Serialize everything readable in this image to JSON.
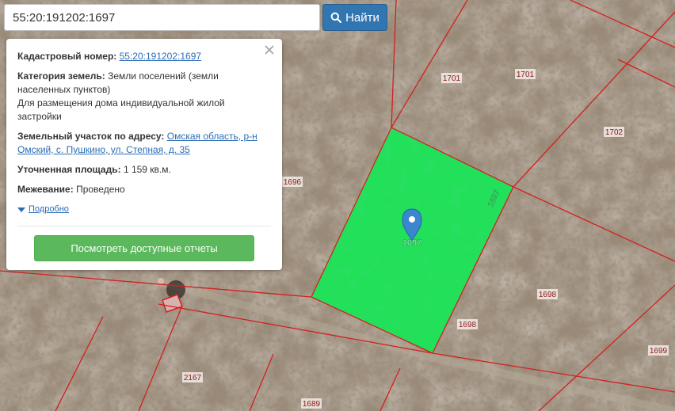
{
  "search": {
    "value": "55:20:191202:1697",
    "button_label": "Найти"
  },
  "info": {
    "cadastral_label": "Кадастровый номер:",
    "cadastral_number": "55:20:191202:1697",
    "category_label": "Категория земель:",
    "category_value": "Земли поселений (земли населенных пунктов)",
    "usage_value": "Для размещения дома индивидуальной жилой застройки",
    "address_label": "Земельный участок по адресу:",
    "address_value": "Омская область, р-н Омский, с. Пушкино, ул. Степная, д. 35",
    "area_label": "Уточненная площадь:",
    "area_value": "1 159 кв.м.",
    "survey_label": "Межевание:",
    "survey_value": "Проведено",
    "details_link": "Подробно",
    "reports_button": "Посмотреть доступные отчеты"
  },
  "map": {
    "parcel_labels": {
      "p1701a": "1701",
      "p1701b": "1701",
      "p1702": "1702",
      "p1696": "1696",
      "p1697_edge": "1697",
      "p1697_center": "1697",
      "p1698a": "1698",
      "p1698b": "1698",
      "p1699": "1699",
      "p2167": "2167",
      "p1689": "1689"
    },
    "colors": {
      "selected_parcel": "#22e05a",
      "boundary": "#d42020",
      "label_text": "#8b1a1a",
      "marker": "#3b86cf"
    }
  }
}
